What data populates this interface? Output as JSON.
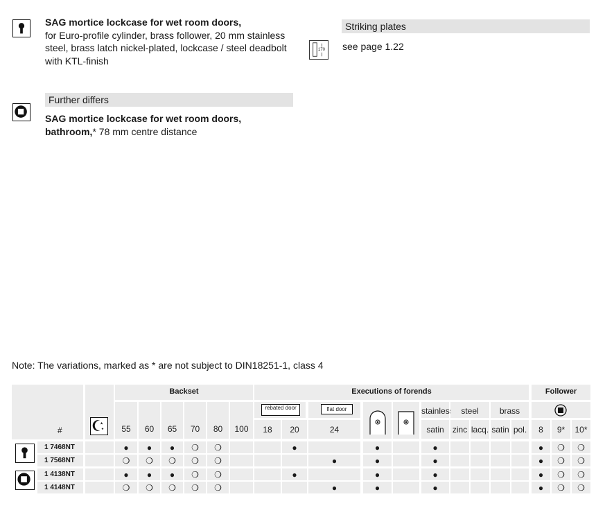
{
  "products": [
    {
      "icon": "euro-cylinder-icon",
      "title": "SAG mortice lockcase for wet room doors,",
      "text_lines": [
        "for Euro-profile cylinder, brass follower, 20 mm stainless",
        "steel, brass latch nickel-plated, lockcase / steel deadbolt",
        "with KTL-finish"
      ]
    },
    {
      "icon": "bathroom-square-icon",
      "bar": "Further differs",
      "title": "SAG mortice lockcase for wet room doors,",
      "title2": "bathroom,",
      "title2_rest": "* 78 mm centre distance"
    }
  ],
  "striking": {
    "bar": "Striking plates",
    "icon": "striking-plate-icon",
    "icon_number": "170",
    "text": "see page 1.22"
  },
  "note": "Note: The variations, marked as * are not subject to DIN18251-1, class 4",
  "table": {
    "hash": "#",
    "group_backset": "Backset",
    "group_forends": "Executions of forends",
    "group_follower": "Follower",
    "backset_cols": [
      "55",
      "60",
      "65",
      "70",
      "80",
      "100"
    ],
    "rebated_label": "rebated door",
    "flat_label": "flat door",
    "rebated_cols": [
      "18",
      "20"
    ],
    "flat_cols": [
      "24"
    ],
    "material_labels": {
      "stainless": "stainless",
      "steel": "steel",
      "brass": "brass"
    },
    "finish_cols": [
      "satin",
      "zinc",
      "lacq.",
      "satin",
      "pol."
    ],
    "follower_cols": [
      "8",
      "9*",
      "10*"
    ],
    "rows": [
      {
        "article": "1 7468NT",
        "backset": [
          "●",
          "●",
          "●",
          "❍",
          "❍",
          ""
        ],
        "rebated": [
          "",
          "●"
        ],
        "flat": [
          ""
        ],
        "round": "●",
        "square": "",
        "finish": [
          "●",
          "",
          "",
          "",
          ""
        ],
        "follower": [
          "●",
          "❍",
          "❍"
        ]
      },
      {
        "article": "1 7568NT",
        "backset": [
          "❍",
          "❍",
          "❍",
          "❍",
          "❍",
          ""
        ],
        "rebated": [
          "",
          ""
        ],
        "flat": [
          "●"
        ],
        "round": "●",
        "square": "",
        "finish": [
          "●",
          "",
          "",
          "",
          ""
        ],
        "follower": [
          "●",
          "❍",
          "❍"
        ]
      },
      {
        "article": "1 4138NT",
        "backset": [
          "●",
          "●",
          "●",
          "❍",
          "❍",
          ""
        ],
        "rebated": [
          "",
          "●"
        ],
        "flat": [
          ""
        ],
        "round": "●",
        "square": "",
        "finish": [
          "●",
          "",
          "",
          "",
          ""
        ],
        "follower": [
          "●",
          "❍",
          "❍"
        ]
      },
      {
        "article": "1 4148NT",
        "backset": [
          "❍",
          "❍",
          "❍",
          "❍",
          "❍",
          ""
        ],
        "rebated": [
          "",
          ""
        ],
        "flat": [
          "●"
        ],
        "round": "●",
        "square": "",
        "finish": [
          "●",
          "",
          "",
          "",
          ""
        ],
        "follower": [
          "●",
          "❍",
          "❍"
        ]
      }
    ]
  }
}
